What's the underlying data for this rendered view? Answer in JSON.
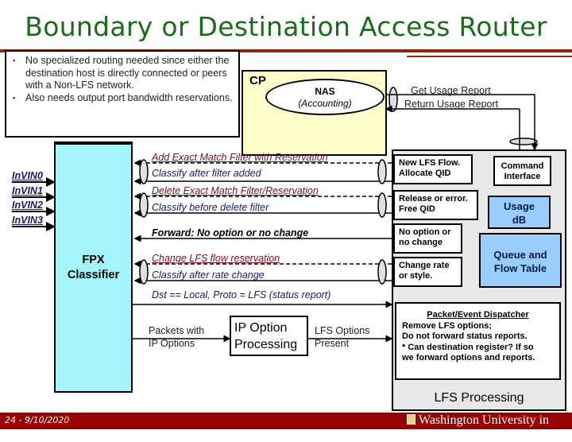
{
  "title": "Boundary or Destination Access Router",
  "notes": [
    "No specialized routing needed since either the destination host is directly connected or peers with a Non-LFS network.",
    "Also needs output port bandwidth reservations."
  ],
  "cp": {
    "label": "CP",
    "nas_title": "NAS",
    "nas_subtitle": "(Accounting)"
  },
  "usage": {
    "get": "Get Usage Report",
    "return": "Return Usage Report"
  },
  "inputs": [
    "InVIN0",
    "InVIN1",
    "InVIN2",
    "InVIN3"
  ],
  "fpx": {
    "line1": "FPX",
    "line2": "Classifier"
  },
  "messages": {
    "add_filter": "Add Exact Match Filter with Reservation",
    "classify_after_add": "Classify after filter added",
    "delete_filter": "Delete Exact Match Filter/Reservation",
    "classify_before_delete": "Classify before delete filter",
    "forward": "Forward: No option or no change",
    "change_reservation": "Change LFS flow reservation",
    "classify_after_rate": "Classify after rate change",
    "status_report": "Dst == Local, Proto = LFS (status report)"
  },
  "ip_option": {
    "input_label_1": "Packets with",
    "input_label_2": "IP Options",
    "box_1": "IP Option",
    "box_2": "Processing",
    "output_label_1": "LFS Options",
    "output_label_2": "Present"
  },
  "lfs": {
    "label": "LFS Processing",
    "new_flow_1": "New LFS Flow.",
    "new_flow_2": "Allocate QID",
    "release_1": "Release or error.",
    "release_2": "Free QID",
    "no_option_1": "No option or",
    "no_option_2": "no change",
    "change_rate_1": "Change rate",
    "change_rate_2": "or style.",
    "command_1": "Command",
    "command_2": "Interface",
    "usage_db_1": "Usage",
    "usage_db_2": "dB",
    "queue_1": "Queue and",
    "queue_2": "Flow Table",
    "dispatcher": {
      "heading": "Packet/Event Dispatcher",
      "lines": [
        "Remove LFS options;",
        "Do not forward status reports.",
        "* Can destination register? If so",
        "we forward options and reports."
      ]
    }
  },
  "footer": {
    "slide": "24 - 9/10/2020",
    "institution": "Washington University in St.Louis"
  }
}
